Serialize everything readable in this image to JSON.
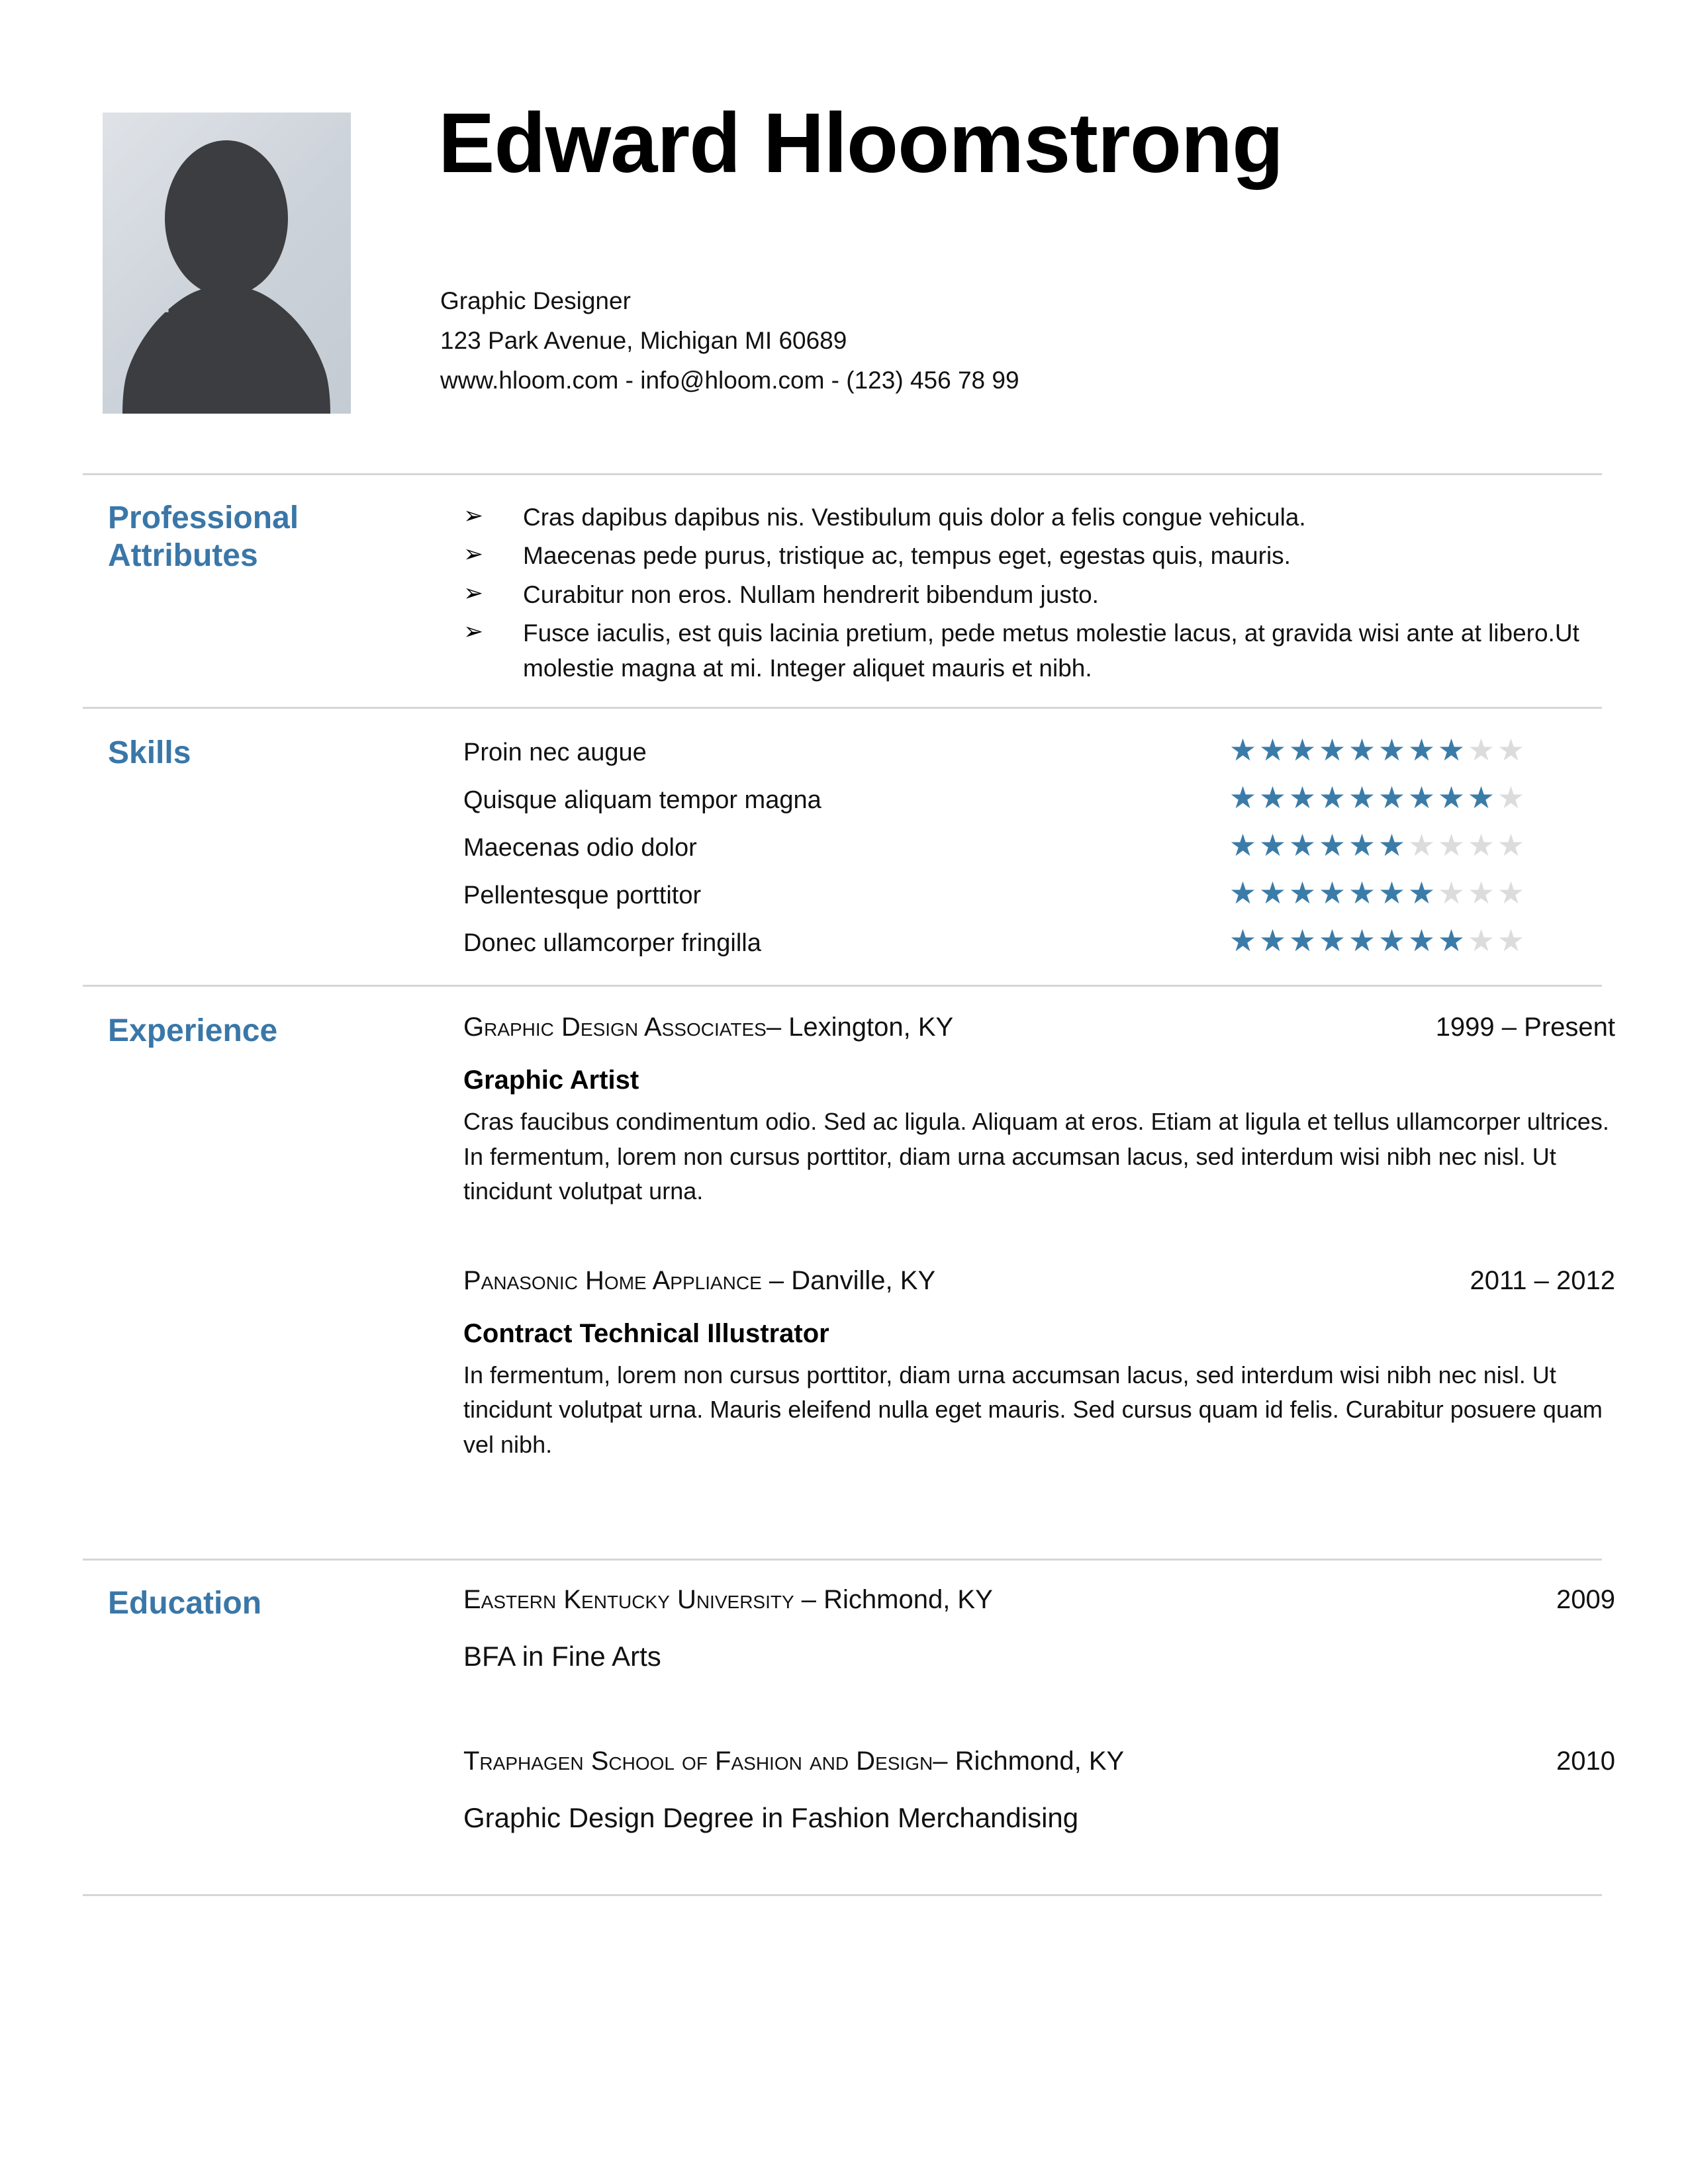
{
  "header": {
    "name": "Edward Hloomstrong",
    "job_title": "Graphic Designer",
    "address": "123 Park Avenue, Michigan MI 60689",
    "contact_line": "www.hloom.com - info@hloom.com - (123) 456 78 99",
    "photo_alt": "person-silhouette-photo"
  },
  "theme": {
    "accent_blue": "#3A77A8",
    "star_filled": "#3B7BA8",
    "star_empty": "#DCDCDC",
    "divider": "#D6D6D6",
    "text": "#111111"
  },
  "sections": {
    "attributes": {
      "title_line1": "Professional",
      "title_line2": "Attributes",
      "bullet_glyph": "➢",
      "items": [
        "Cras dapibus dapibus nis. Vestibulum quis dolor a felis congue vehicula.",
        "Maecenas pede purus, tristique ac, tempus eget, egestas quis, mauris.",
        "Curabitur non eros. Nullam hendrerit bibendum justo.",
        "Fusce iaculis, est quis lacinia pretium, pede metus molestie lacus, at gravida wisi ante at libero.Ut molestie magna at mi. Integer aliquet mauris et nibh."
      ]
    },
    "skills": {
      "title": "Skills",
      "max_rating": 10,
      "items": [
        {
          "name": "Proin nec augue",
          "rating": 8
        },
        {
          "name": "Quisque aliquam tempor magna",
          "rating": 9
        },
        {
          "name": "Maecenas odio dolor",
          "rating": 6
        },
        {
          "name": "Pellentesque porttitor",
          "rating": 7
        },
        {
          "name": "Donec ullamcorper fringilla",
          "rating": 8
        }
      ]
    },
    "experience": {
      "title": "Experience",
      "entries": [
        {
          "org_caps": "Graphic Design Associates",
          "org_plain": "– Lexington, KY",
          "dates": "1999 – Present",
          "role": "Graphic Artist",
          "description": "Cras faucibus condimentum odio. Sed ac ligula. Aliquam at eros. Etiam at ligula et tellus ullamcorper ultrices. In fermentum, lorem non cursus porttitor, diam urna accumsan lacus, sed interdum wisi nibh nec nisl. Ut tincidunt volutpat urna."
        },
        {
          "org_caps": "Panasonic Home Appliance",
          "org_plain": " – Danville, KY",
          "dates": "2011 – 2012",
          "role": "Contract Technical Illustrator",
          "description": "In fermentum, lorem non cursus porttitor, diam urna accumsan lacus, sed interdum wisi nibh nec nisl. Ut tincidunt volutpat urna. Mauris eleifend nulla eget mauris. Sed cursus quam id felis. Curabitur posuere quam vel nibh."
        }
      ]
    },
    "education": {
      "title": "Education",
      "entries": [
        {
          "org_caps": "Eastern Kentucky University",
          "org_plain": " – Richmond, KY",
          "dates": "2009",
          "degree": "BFA in Fine Arts"
        },
        {
          "org_caps": "Traphagen School of Fashion and Design",
          "org_plain": "– Richmond, KY",
          "dates": "2010",
          "degree": "Graphic Design Degree in Fashion Merchandising"
        }
      ]
    }
  }
}
